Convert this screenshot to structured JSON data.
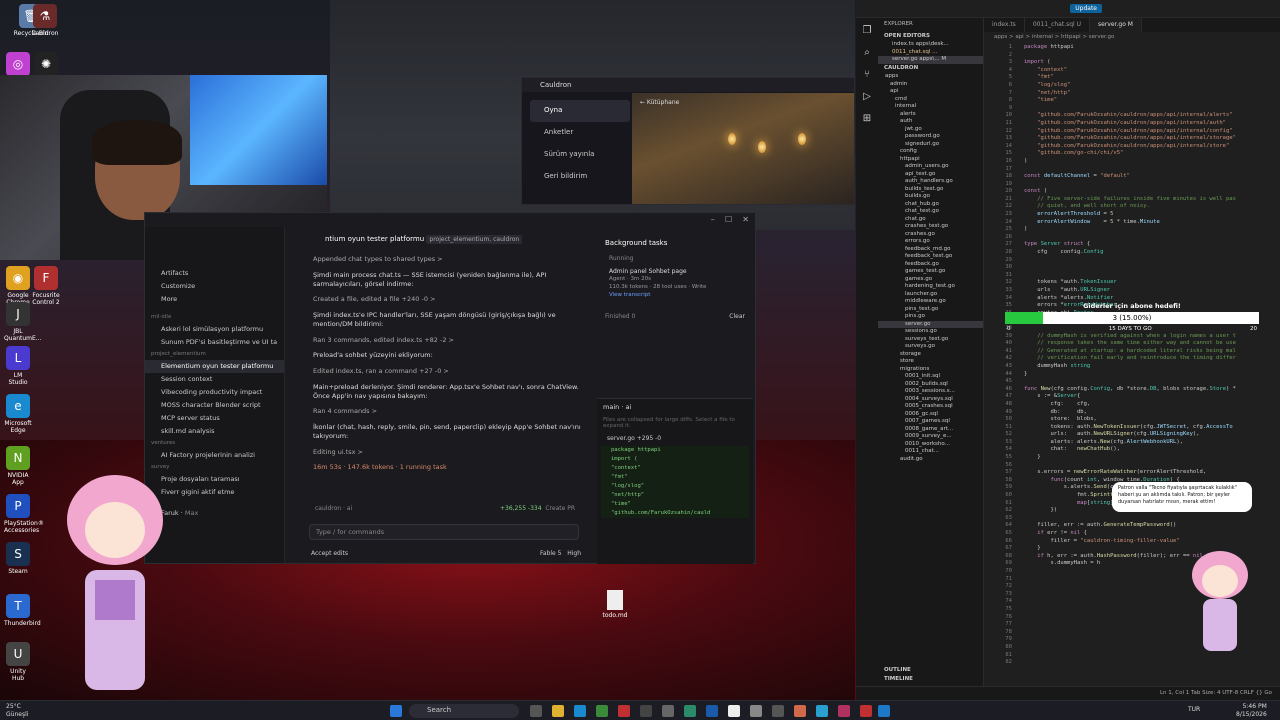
{
  "desktop": {
    "icons": [
      {
        "label": "Recycle Bin"
      },
      {
        "label": "Cauldron"
      },
      {
        "label": "Google Chrome"
      },
      {
        "label": "Focusrite Control 2"
      },
      {
        "label": "JBL QuantumE..."
      },
      {
        "label": "LM Studio"
      },
      {
        "label": "Microsoft Edge"
      },
      {
        "label": "NVIDIA App"
      },
      {
        "label": "PlayStation® Accessories"
      },
      {
        "label": "Steam"
      },
      {
        "label": "Thunderbird"
      },
      {
        "label": "Unity Hub"
      }
    ],
    "file": {
      "label": "todo.md"
    }
  },
  "cauldron": {
    "title": "Cauldron",
    "menu": [
      "Oyna",
      "Anketler",
      "Sürüm yayınla",
      "Geri bildirim"
    ],
    "back": "← Kütüphane"
  },
  "claude": {
    "header_title": "ntium oyun tester platformu",
    "header_tag": "project_elementium, cauldron",
    "sidebar": {
      "items": [
        "Artifacts",
        "Customize",
        "More"
      ],
      "section1": "mil-idle",
      "s1": [
        "Askeri lol simülasyon platformu",
        "Sunum PDF'si basitleştirme ve UI ta"
      ],
      "section2": "project_elementium",
      "s2": [
        "Elementium oyun tester platformu",
        "Session context",
        "Vibecoding productivity impact",
        "MOSS character Blender script",
        "MCP server status",
        "skill.md analysis"
      ],
      "section3": "ventures",
      "s3": [
        "AI Factory projelerinin analizi"
      ],
      "section4": "survey",
      "s4": [
        "Proje dosyaları taraması",
        "Fiverr gigini aktif etme"
      ],
      "user": "Faruk",
      "plan": "Max"
    },
    "messages": [
      "Appended chat types to shared types >",
      "Şimdi main process chat.ts — SSE istemcisi (yeniden bağlanma ile), API sarmalayıcıları, görsel indirme:",
      "Created a file, edited a file +240 -0 >",
      "Şimdi index.ts'e IPC handler'ları, SSE yaşam döngüsü (giriş/çıkışa bağlı) ve mention/DM bildirimi:",
      "Ran 3 commands, edited index.ts +82 -2 >",
      "Preload'a sohbet yüzeyini ekliyorum:",
      "Edited index.ts, ran a command +27 -0 >",
      "Main+preload derleniyor. Şimdi renderer: App.tsx'e Sohbet nav'ı, sonra ChatView. Önce App'in nav yapısına bakayım:",
      "Ran 4 commands >",
      "İkonlar (chat, hash, reply, smile, pin, send, paperclip) ekleyip App'e Sohbet nav'ını takıyorum:",
      "Editing ui.tsx >"
    ],
    "status": "16m 53s · 147.6k tokens · 1 running task",
    "branch": "cauldron · ai",
    "diffstat": "+36,255 -334",
    "create_pr": "Create PR",
    "input_placeholder": "Type / for commands",
    "accept_edits": "Accept edits",
    "model": "Fable 5",
    "effort": "High",
    "bg": {
      "title": "Background tasks",
      "running": "Running",
      "task": "Admin panel Sohbet page",
      "agent": "Agent · 3m 20s",
      "stats": "110.3k tokens · 28 tool uses · Write",
      "link": "View transcript",
      "finished": "Finished 0",
      "clear": "Clear"
    },
    "diff": {
      "title": "main · ai",
      "note": "Files are collapsed for large diffs. Select a file to expand it.",
      "file": "server.go +295 -0",
      "lines": [
        "package httpapi",
        "",
        "import (",
        "  \"context\"",
        "  \"fmt\"",
        "  \"log/slog\"",
        "  \"net/http\"",
        "  \"time\"",
        "",
        "  \"github.com/FarukOzsahin/cauld"
      ]
    }
  },
  "vscode": {
    "tabs": [
      "index.ts",
      "0011_chat.sql U",
      "server.go M"
    ],
    "breadcrumb": "apps > api > internal > httpapi > server.go",
    "update": "Update",
    "explorer": {
      "title": "EXPLORER",
      "open_editors": "OPEN EDITORS",
      "open": [
        "index.ts apps\\desk...",
        "0011_chat.sql ...",
        "server.go apps\\... M"
      ],
      "root": "CAULDRON",
      "tree": [
        "apps",
        "admin",
        "api",
        "cmd",
        "internal",
        "alerts",
        "auth",
        "jwt.go",
        "password.go",
        "signedurl.go",
        "config",
        "httpapi",
        "admin_users.go",
        "api_test.go",
        "auth_handlers.go",
        "builds_test.go",
        "builds.go",
        "chat_hub.go",
        "chat_test.go",
        "chat.go",
        "crashes_test.go",
        "crashes.go",
        "errors.go",
        "feedback_md.go",
        "feedback_test.go",
        "feedback.go",
        "games_test.go",
        "games.go",
        "hardening_test.go",
        "launcher.go",
        "middleware.go",
        "pins_test.go",
        "pins.go",
        "server.go",
        "sessions.go",
        "surveys_test.go",
        "surveys.go",
        "storage",
        "store",
        "migrations",
        "0001_init.sql",
        "0002_builds.sql",
        "0003_sessions.s...",
        "0004_surveys.sql",
        "0005_crashes.sql",
        "0006_gc.sql",
        "0007_games.sql",
        "0008_game_art...",
        "0009_survey_e...",
        "0010_worksho...",
        "0011_chat...",
        "audit.go"
      ],
      "outline": "OUTLINE",
      "timeline": "TIMELINE"
    },
    "statusbar": "Ln 1, Col 1   Tab Size: 4   UTF-8   CRLF   {} Go"
  },
  "overlay": {
    "title": "Giderler için abone hedefi!",
    "value_text": "3 (15.00%)",
    "progress": 0.15,
    "left": "0",
    "days": "15 DAYS TO GO",
    "right": "20",
    "bubble": "Patron valla \"Tecno fiyatıyla şaşırtacak kulaklık\" haberi şu an aklımda takılı. Patron; bir şeyler duyarsan hatırlatır mısın, merak ettim!"
  },
  "taskbar": {
    "weather_temp": "25°C",
    "weather_desc": "Güneşli",
    "search": "Search",
    "lang": "TUR",
    "time": "5:46 PM",
    "date": "8/15/2026"
  }
}
